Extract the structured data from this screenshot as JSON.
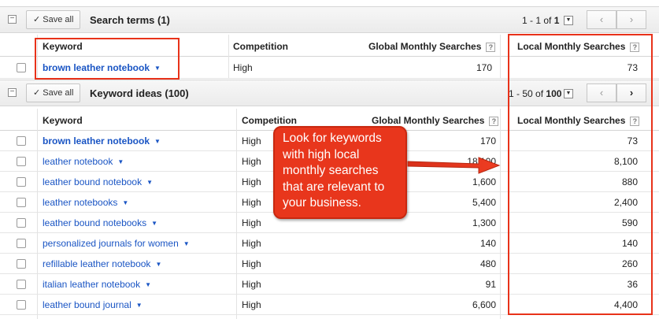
{
  "search_terms_section": {
    "collapse_symbol": "−",
    "save_all_label": "Save all",
    "save_all_check": "✓",
    "title": "Search terms (1)",
    "pager_range": "1 - 1",
    "pager_of": "of",
    "pager_total": "1",
    "dropdown_symbol": "▼",
    "prev_symbol": "‹",
    "next_symbol": "›",
    "headers": {
      "keyword": "Keyword",
      "competition": "Competition",
      "global": "Global Monthly Searches",
      "local": "Local Monthly Searches",
      "help": "?"
    },
    "rows": [
      {
        "keyword": "brown leather notebook",
        "competition": "High",
        "global": "170",
        "local": "73"
      }
    ]
  },
  "keyword_ideas_section": {
    "collapse_symbol": "−",
    "save_all_label": "Save all",
    "save_all_check": "✓",
    "title": "Keyword ideas (100)",
    "pager_range": "1 - 50",
    "pager_of": "of",
    "pager_total": "100",
    "dropdown_symbol": "▼",
    "prev_symbol": "‹",
    "next_symbol": "›",
    "headers": {
      "keyword": "Keyword",
      "competition": "Competition",
      "global": "Global Monthly Searches",
      "local": "Local Monthly Searches",
      "help": "?"
    },
    "rows": [
      {
        "keyword": "brown leather notebook",
        "competition": "High",
        "global": "170",
        "local": "73",
        "bold": true
      },
      {
        "keyword": "leather notebook",
        "competition": "High",
        "global": "18,100",
        "local": "8,100"
      },
      {
        "keyword": "leather bound notebook",
        "competition": "High",
        "global": "1,600",
        "local": "880"
      },
      {
        "keyword": "leather notebooks",
        "competition": "High",
        "global": "5,400",
        "local": "2,400"
      },
      {
        "keyword": "leather bound notebooks",
        "competition": "High",
        "global": "1,300",
        "local": "590"
      },
      {
        "keyword": "personalized journals for women",
        "competition": "High",
        "global": "140",
        "local": "140"
      },
      {
        "keyword": "refillable leather notebook",
        "competition": "High",
        "global": "480",
        "local": "260"
      },
      {
        "keyword": "italian leather notebook",
        "competition": "High",
        "global": "91",
        "local": "36"
      },
      {
        "keyword": "leather bound journal",
        "competition": "High",
        "global": "6,600",
        "local": "4,400"
      }
    ]
  },
  "annotation": {
    "callout_text": "Look for keywords with high local monthly searches that are relevant to your business."
  },
  "colors": {
    "link": "#1a55c4",
    "annotation_red": "#e8321a"
  }
}
